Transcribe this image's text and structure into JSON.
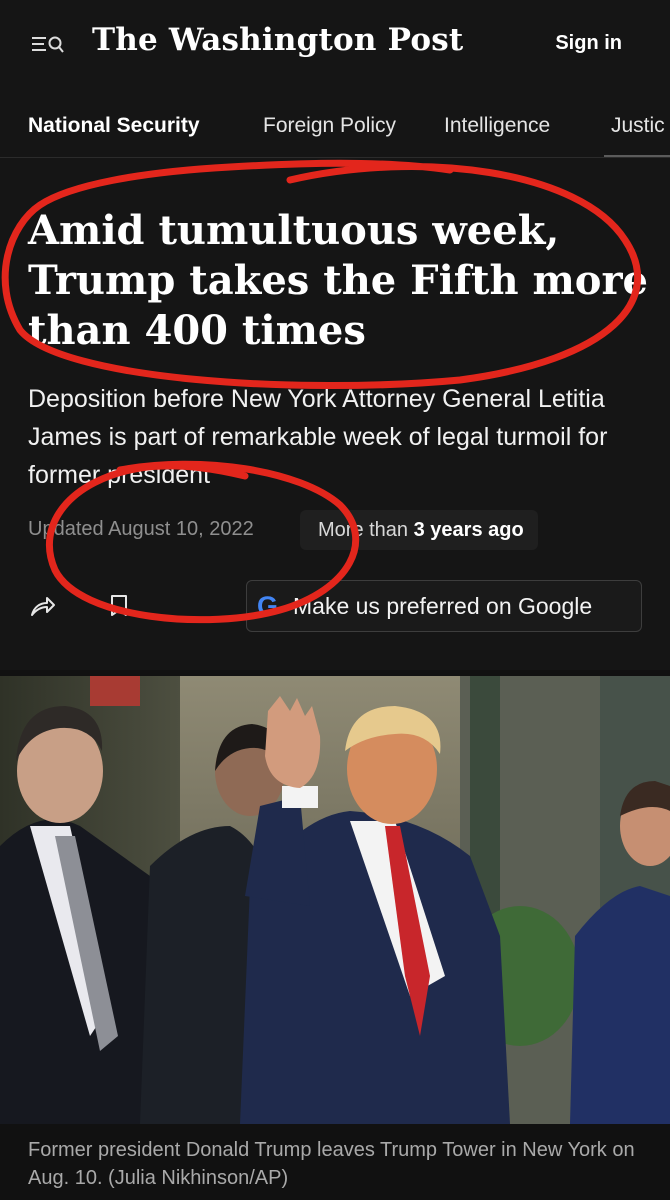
{
  "header": {
    "menu_icon": "menu-search-icon",
    "logo": "The Washington Post",
    "signin_label": "Sign in"
  },
  "nav": {
    "items": [
      "National Security",
      "Foreign Policy",
      "Intelligence",
      "Justic"
    ],
    "active": "National Security"
  },
  "article": {
    "headline": "Amid tumultuous week, Trump takes the Fifth more than 400 times",
    "dek": "Deposition before New York Attorney General Letitia James is part of remarkable week of legal turmoil for former president",
    "dateline": "Updated August 10, 2022",
    "age_prefix": "More than",
    "age_value": "3 years ago",
    "share_icon": "share-icon",
    "bookmark_icon": "bookmark-icon",
    "google_icon": "google-logo-icon",
    "google_label": "Make us preferred on Google"
  },
  "photo": {
    "caption": "Former president Donald Trump leaves Trump Tower in New York on Aug. 10. (Julia Nikhinson/AP)"
  },
  "colors": {
    "background": "#111111",
    "annotation_red": "#e3261c",
    "google_blue": "#4285f4",
    "google_red": "#ea4335",
    "google_yellow": "#fbbc05",
    "google_green": "#34a853"
  }
}
